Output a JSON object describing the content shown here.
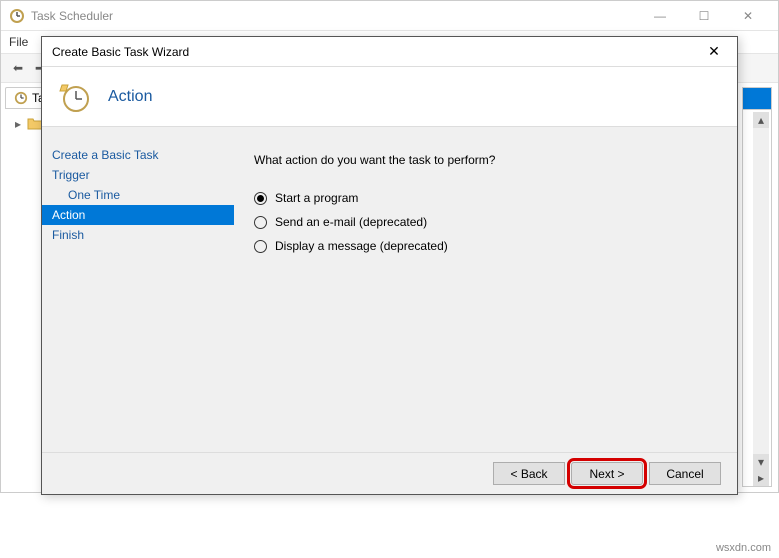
{
  "main_window": {
    "title": "Task Scheduler",
    "menu": {
      "file": "File"
    },
    "tree_tab": "Tas",
    "tree_item_expander": "▸"
  },
  "wizard": {
    "title": "Create Basic Task Wizard",
    "heading": "Action",
    "steps": {
      "create": "Create a Basic Task",
      "trigger": "Trigger",
      "onetime": "One Time",
      "action": "Action",
      "finish": "Finish"
    },
    "prompt": "What action do you want the task to perform?",
    "options": {
      "start": "Start a program",
      "email": "Send an e-mail (deprecated)",
      "message": "Display a message (deprecated)"
    },
    "buttons": {
      "back": "< Back",
      "next": "Next >",
      "cancel": "Cancel"
    }
  },
  "watermark": "wsxdn.com"
}
